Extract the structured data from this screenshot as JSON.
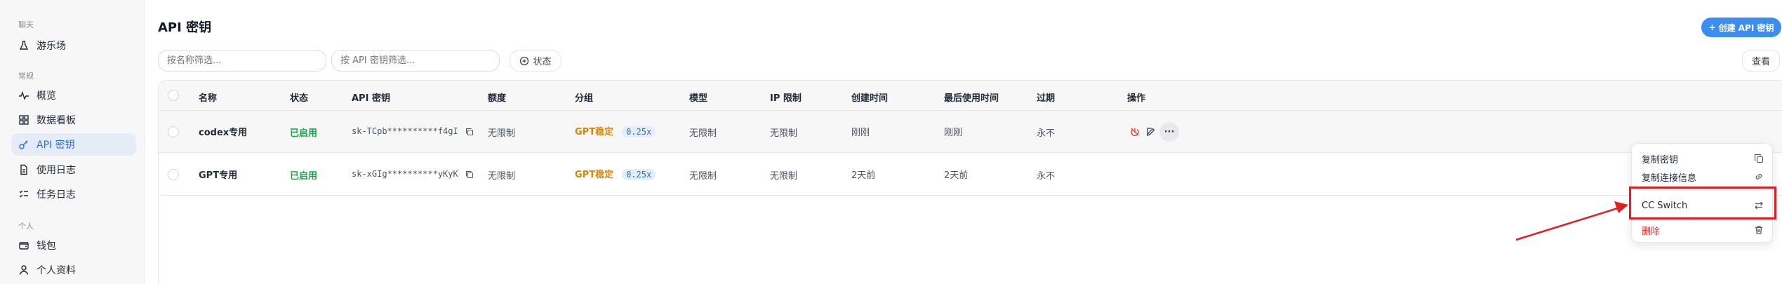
{
  "sidebar": {
    "groups": [
      "聊天",
      "常规",
      "个人"
    ],
    "items": [
      {
        "label": "游乐场",
        "icon": "flask-icon"
      },
      {
        "label": "概览",
        "icon": "activity-icon"
      },
      {
        "label": "数据看板",
        "icon": "dashboard-icon"
      },
      {
        "label": "API 密钥",
        "icon": "key-icon"
      },
      {
        "label": "使用日志",
        "icon": "document-icon"
      },
      {
        "label": "任务日志",
        "icon": "task-list-icon"
      },
      {
        "label": "钱包",
        "icon": "wallet-icon"
      },
      {
        "label": "个人资料",
        "icon": "user-icon"
      }
    ],
    "active_index": 3
  },
  "header": {
    "title": "API 密钥",
    "create_button": "创建 API 密钥",
    "view_button": "查看"
  },
  "filters": {
    "name_placeholder": "按名称筛选...",
    "key_placeholder": "按 API 密钥筛选...",
    "status_label": "状态"
  },
  "table": {
    "columns": [
      "名称",
      "状态",
      "API 密钥",
      "额度",
      "分组",
      "模型",
      "IP 限制",
      "创建时间",
      "最后使用时间",
      "过期",
      "操作"
    ],
    "rows": [
      {
        "name": "codex专用",
        "status": "已启用",
        "key": "sk-TCpb**********f4gI",
        "quota": "无限制",
        "group": "GPT稳定",
        "ratio": "0.25x",
        "model": "无限制",
        "ip": "无限制",
        "created": "刚刚",
        "last_used": "刚刚",
        "expires": "永不"
      },
      {
        "name": "GPT专用",
        "status": "已启用",
        "key": "sk-xGIg**********yKyK",
        "quota": "无限制",
        "group": "GPT稳定",
        "ratio": "0.25x",
        "model": "无限制",
        "ip": "无限制",
        "created": "2天前",
        "last_used": "2天前",
        "expires": "永不"
      }
    ]
  },
  "menu": {
    "items": [
      {
        "label": "复制密钥",
        "icon": "copy-icon"
      },
      {
        "label": "复制连接信息",
        "icon": "link-icon"
      },
      {
        "label": "CC Switch",
        "icon": "switch-arrows-icon"
      },
      {
        "label": "删除",
        "icon": "trash-icon"
      }
    ]
  },
  "colors": {
    "accent": "#3b8ef0",
    "active_bg": "#e6ecf7",
    "enabled": "#16a34a",
    "group": "#d48806",
    "danger": "#e53935",
    "annotation": "#e02020"
  }
}
